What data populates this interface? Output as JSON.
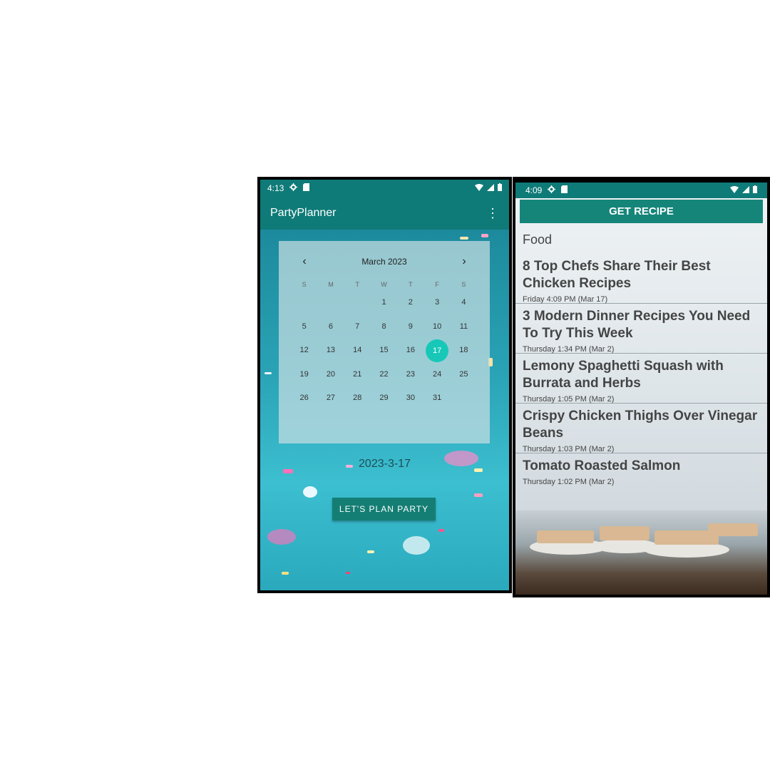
{
  "phone1": {
    "status": {
      "time": "4:13"
    },
    "appbar": {
      "title": "PartyPlanner",
      "menu": "⋮"
    },
    "calendar": {
      "month_label": "March 2023",
      "prev": "‹",
      "next": "›",
      "weekdays": [
        "S",
        "M",
        "T",
        "W",
        "T",
        "F",
        "S"
      ],
      "days": [
        "",
        "",
        "",
        "1",
        "2",
        "3",
        "4",
        "5",
        "6",
        "7",
        "8",
        "9",
        "10",
        "11",
        "12",
        "13",
        "14",
        "15",
        "16",
        "17",
        "18",
        "19",
        "20",
        "21",
        "22",
        "23",
        "24",
        "25",
        "26",
        "27",
        "28",
        "29",
        "30",
        "31",
        ""
      ],
      "selected": "17"
    },
    "selected_date": "2023-3-17",
    "button_label": "LET'S PLAN PARTY"
  },
  "phone2": {
    "status": {
      "time": "4:09"
    },
    "button_label": "GET RECIPE",
    "category": "Food",
    "articles": [
      {
        "title": "8 Top Chefs Share Their Best Chicken Recipes",
        "date": "Friday 4:09 PM (Mar 17)"
      },
      {
        "title": "3 Modern Dinner Recipes You Need To Try This Week",
        "date": "Thursday 1:34 PM (Mar 2)"
      },
      {
        "title": "Lemony Spaghetti Squash with Burrata and Herbs",
        "date": "Thursday 1:05 PM (Mar 2)"
      },
      {
        "title": "Crispy Chicken Thighs Over Vinegar Beans",
        "date": "Thursday 1:03 PM (Mar 2)"
      },
      {
        "title": "Tomato Roasted Salmon",
        "date": "Thursday 1:02 PM (Mar 2)"
      }
    ]
  },
  "colors": {
    "primary": "#0f7b78",
    "accent": "#17c8b8",
    "button": "#157e74"
  },
  "icons": [
    "settings-icon",
    "sim-card-icon",
    "wifi-icon",
    "signal-icon",
    "battery-icon",
    "overflow-menu-icon",
    "chevron-left-icon",
    "chevron-right-icon"
  ]
}
